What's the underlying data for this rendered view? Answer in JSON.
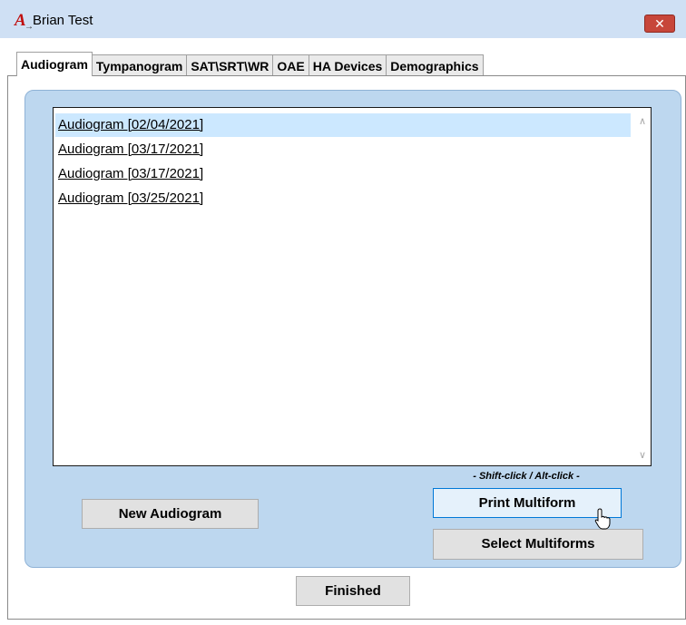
{
  "window": {
    "title": "Brian Test",
    "app_icon": {
      "glyph": "A",
      "sub": "→"
    },
    "close_glyph": "✕"
  },
  "tabs": [
    {
      "label": "Audiogram",
      "active": true
    },
    {
      "label": "Tympanogram",
      "active": false
    },
    {
      "label": "SAT\\SRT\\WR",
      "active": false
    },
    {
      "label": "OAE",
      "active": false
    },
    {
      "label": "HA Devices",
      "active": false
    },
    {
      "label": "Demographics",
      "active": false
    }
  ],
  "list": {
    "items": [
      {
        "label": "Audiogram  [02/04/2021]",
        "selected": true
      },
      {
        "label": "Audiogram  [03/17/2021]",
        "selected": false
      },
      {
        "label": "Audiogram  [03/17/2021]",
        "selected": false
      },
      {
        "label": "Audiogram  [03/25/2021]",
        "selected": false
      }
    ],
    "scroll_up_glyph": "∧",
    "scroll_down_glyph": "∨"
  },
  "hint": "- Shift-click / Alt-click -",
  "buttons": {
    "new_audiogram": "New Audiogram",
    "print_multiform": "Print Multiform",
    "select_multiforms": "Select Multiforms",
    "finished": "Finished"
  },
  "colors": {
    "titlebar": "#cfe0f4",
    "panel": "#bdd7ef",
    "selection": "#cce8ff",
    "focused_border": "#0078d7",
    "close_button": "#c7463a"
  }
}
